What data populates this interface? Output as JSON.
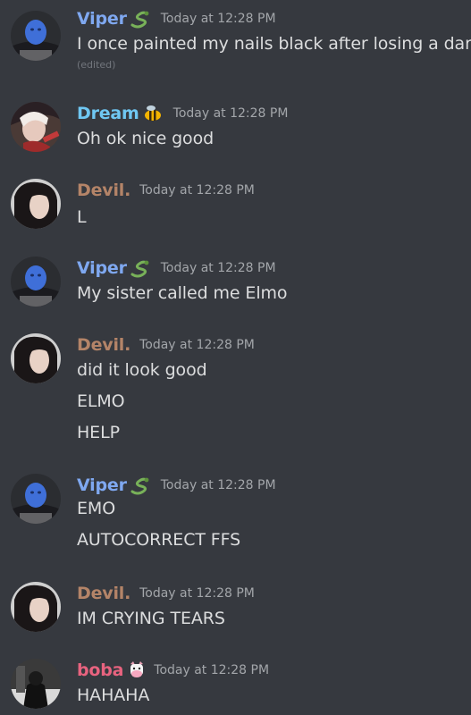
{
  "colors": {
    "background": "#36393f",
    "viper": "#7fa8f0",
    "dream": "#6fc7f2",
    "devil": "#b48468",
    "boba": "#e8637f",
    "timestamp": "#a3a6aa",
    "text": "#dcddde"
  },
  "messages": [
    {
      "author": "Viper",
      "badge_icon": "snake-icon",
      "timestamp": "Today at 12:28 PM",
      "lines": [
        "I once painted my nails black after losing a dare"
      ],
      "edited": "(edited)"
    },
    {
      "author": "Dream",
      "badge_icon": "bee-icon",
      "timestamp": "Today at 12:28 PM",
      "lines": [
        "Oh ok nice good"
      ]
    },
    {
      "author": "Devil.",
      "timestamp": "Today at 12:28 PM",
      "lines": [
        "L"
      ]
    },
    {
      "author": "Viper",
      "badge_icon": "snake-icon",
      "timestamp": "Today at 12:28 PM",
      "lines": [
        "My sister called me Elmo"
      ]
    },
    {
      "author": "Devil.",
      "timestamp": "Today at 12:28 PM",
      "lines": [
        "did it look good",
        "ELMO",
        "HELP"
      ]
    },
    {
      "author": "Viper",
      "badge_icon": "snake-icon",
      "timestamp": "Today at 12:28 PM",
      "lines": [
        "EMO",
        "AUTOCORRECT FFS"
      ]
    },
    {
      "author": "Devil.",
      "timestamp": "Today at 12:28 PM",
      "lines": [
        "IM CRYING TEARS"
      ]
    },
    {
      "author": "boba",
      "badge_icon": "cow-icon",
      "timestamp": "Today at 12:28 PM",
      "lines": [
        "HAHAHA"
      ]
    }
  ]
}
